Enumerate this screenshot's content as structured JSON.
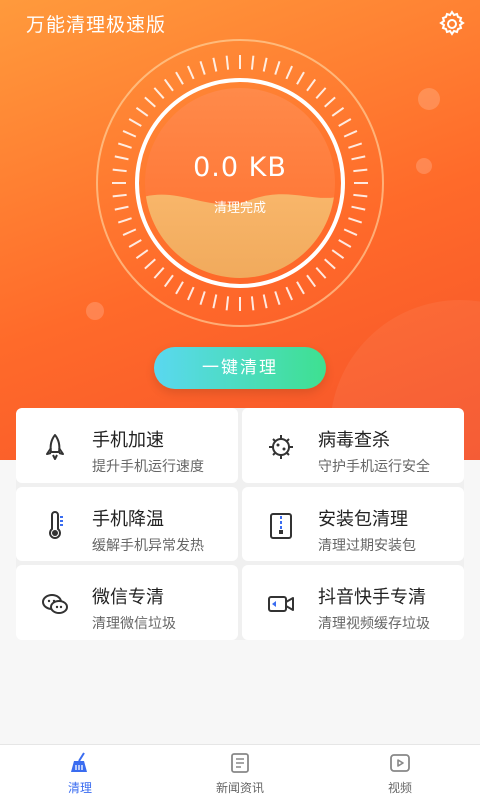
{
  "app": {
    "title": "万能清理极速版"
  },
  "dial": {
    "size": "0.0 KB",
    "status": "清理完成"
  },
  "action": {
    "clean_label": "一键清理"
  },
  "features": [
    {
      "title": "手机加速",
      "subtitle": "提升手机运行速度",
      "icon": "rocket-icon"
    },
    {
      "title": "病毒查杀",
      "subtitle": "守护手机运行安全",
      "icon": "virus-icon"
    },
    {
      "title": "手机降温",
      "subtitle": "缓解手机异常发热",
      "icon": "thermometer-icon"
    },
    {
      "title": "安装包清理",
      "subtitle": "清理过期安装包",
      "icon": "package-icon"
    },
    {
      "title": "微信专清",
      "subtitle": "清理微信垃圾",
      "icon": "wechat-icon"
    },
    {
      "title": "抖音快手专清",
      "subtitle": "清理视频缓存垃圾",
      "icon": "video-icon"
    }
  ],
  "tabs": [
    {
      "label": "清理",
      "icon": "broom-icon",
      "active": true
    },
    {
      "label": "新闻资讯",
      "icon": "news-icon",
      "active": false
    },
    {
      "label": "视频",
      "icon": "play-icon",
      "active": false
    }
  ],
  "colors": {
    "accent": "#ff6a2a",
    "button_start": "#5ad8f0",
    "button_end": "#3ee090",
    "tab_active": "#3a6cf0"
  }
}
